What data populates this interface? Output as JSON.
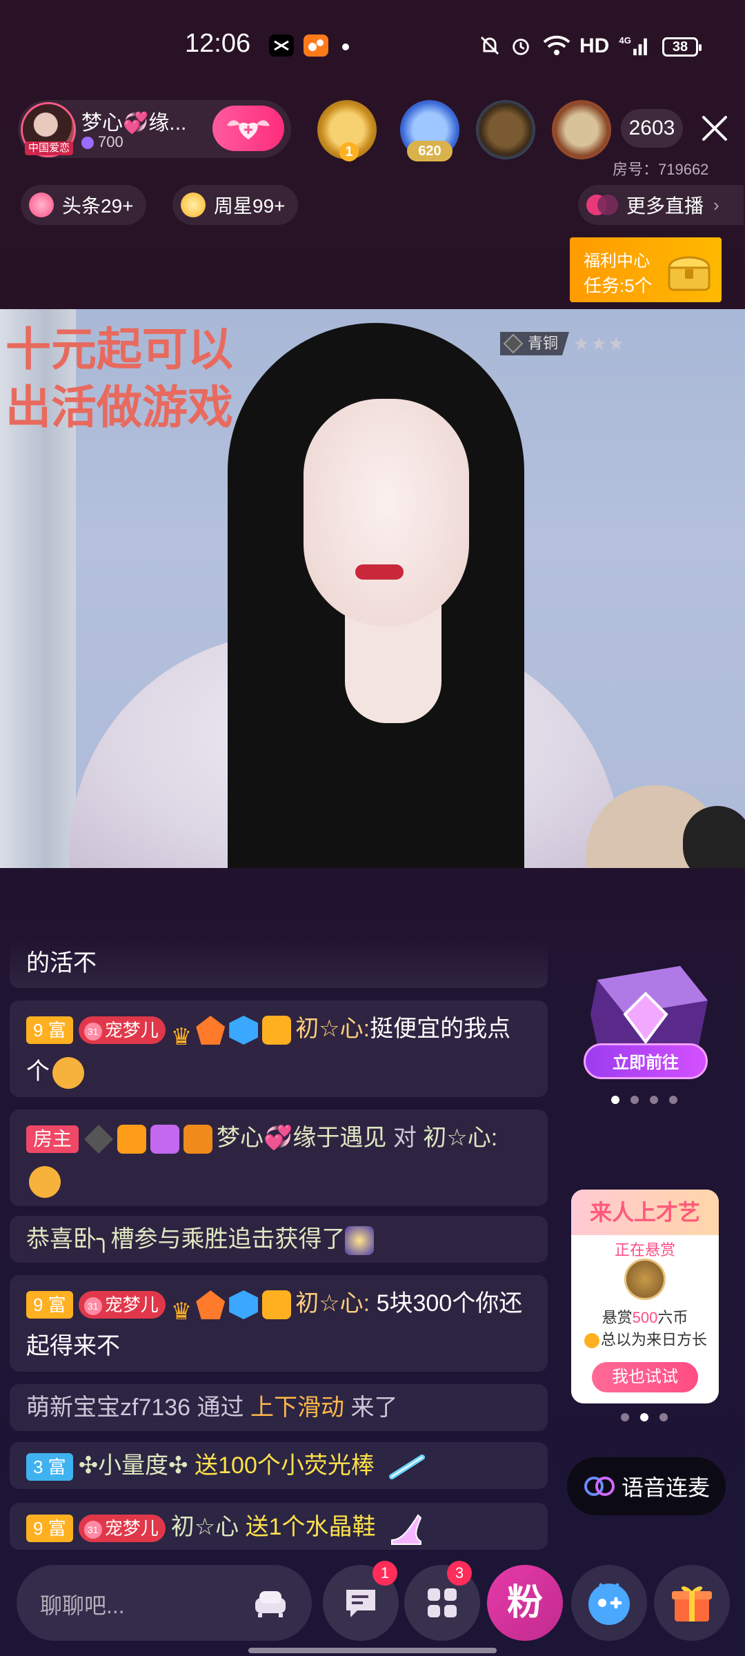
{
  "status_bar": {
    "time": "12:06",
    "network": "HD",
    "signal": "4G",
    "battery": "38"
  },
  "host": {
    "name": "梦心💞缘...",
    "fans": "700",
    "avatar_tag": "中国爱恋"
  },
  "viewers": {
    "badge_1": "1",
    "badge_2": "620",
    "count": "2603"
  },
  "room": {
    "id_label": "房号：719662"
  },
  "tags": {
    "headline": "头条29+",
    "week_star": "周星99+",
    "more_live": "更多直播"
  },
  "welfare": {
    "title": "福利中心",
    "task": "任务:5个"
  },
  "video": {
    "overlay_line1": "十元起可以",
    "overlay_line2": "出活做游戏",
    "rank": "青铜",
    "stars": "★★★"
  },
  "chat": {
    "row0_text": "的活不",
    "row1_rich": "9 富",
    "row1_fan_level": "31",
    "row1_fan_name": "宠梦儿",
    "row1_name": "初☆心:",
    "row1_msg": "挺便宜的我点个",
    "row2_host_badge": "房主",
    "row2_name": "梦心💞缘于遇见",
    "row2_to": "对",
    "row2_target": "初☆心:",
    "row3_prefix": "恭喜卧╮",
    "row3_msg": "槽参与乘胜追击获得了",
    "row4_rich": "9 富",
    "row4_fan_level": "31",
    "row4_fan_name": "宠梦儿",
    "row4_name": "初☆心:",
    "row4_msg": "5块300个你还起得来不",
    "row5_user": "萌新宝宝zf7136",
    "row5_via": "通过",
    "row5_action": "上下滑动",
    "row5_came": "来了",
    "row6_rich": "3 富",
    "row6_name": "✣小量度✣",
    "row6_gift": "送100个小荧光棒",
    "row7_rich": "9 富",
    "row7_fan_level": "31",
    "row7_fan_name": "宠梦儿",
    "row7_name": "初☆心",
    "row7_gift": "送1个水晶鞋"
  },
  "promo": {
    "button": "立即前往"
  },
  "talent": {
    "title": "来人上才艺",
    "subtitle": "正在悬赏",
    "reward_prefix": "悬赏",
    "reward_amount": "500",
    "reward_unit": "六币",
    "desc": "总以为来日方长",
    "button": "我也试试"
  },
  "voice_link": {
    "label": "语音连麦"
  },
  "bottom_bar": {
    "chat_placeholder": "聊聊吧...",
    "message_badge": "1",
    "apps_badge": "3",
    "fan_label": "粉"
  },
  "colors": {
    "accent_pink": "#ff2d7a",
    "rich_gold": "#ffb021",
    "gift_yellow": "#ffe24a",
    "welfare_orange": "#ffa800"
  }
}
